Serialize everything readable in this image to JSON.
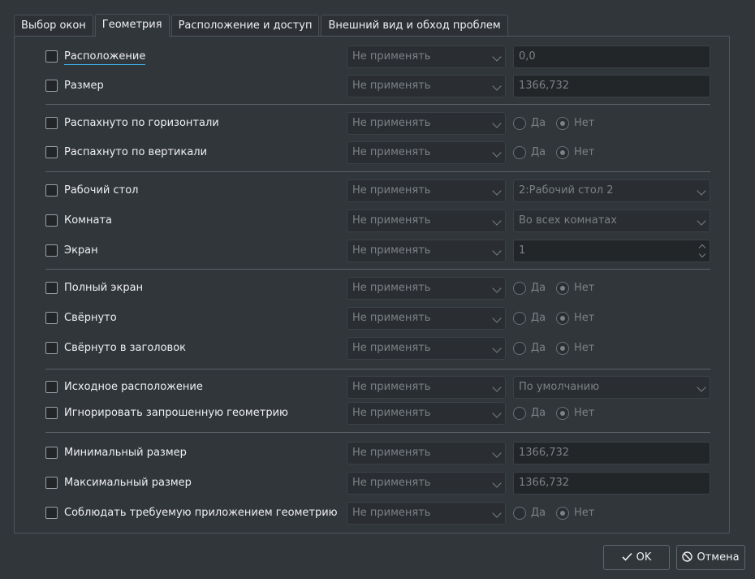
{
  "tabs": [
    "Выбор окон",
    "Геометрия",
    "Расположение и доступ",
    "Внешний вид и обход проблем"
  ],
  "active_tab": "Геометрия",
  "combo_default": "Не применять",
  "radio_yes": "Да",
  "radio_no": "Нет",
  "rows": {
    "position": {
      "label": "Расположение",
      "value": "0,0"
    },
    "size": {
      "label": "Размер",
      "value": "1366,732"
    },
    "max_horiz": {
      "label": "Распахнуто по горизонтали"
    },
    "max_vert": {
      "label": "Распахнуто по вертикали"
    },
    "desktop": {
      "label": "Рабочий стол",
      "value": "2:Рабочий стол 2"
    },
    "activity": {
      "label": "Комната",
      "value": "Во всех комнатах"
    },
    "screen": {
      "label": "Экран",
      "value": "1"
    },
    "fullscreen": {
      "label": "Полный экран"
    },
    "minimized": {
      "label": "Свёрнуто"
    },
    "shaded": {
      "label": "Свёрнуто в заголовок"
    },
    "placement": {
      "label": "Исходное расположение",
      "value": "По умолчанию"
    },
    "ignore_geom": {
      "label": "Игнорировать запрошенную геометрию"
    },
    "min_size": {
      "label": "Минимальный размер",
      "value": "1366,732"
    },
    "max_size": {
      "label": "Максимальный размер",
      "value": "1366,732"
    },
    "obey_geom": {
      "label": "Соблюдать требуемую приложением геометрию"
    }
  },
  "buttons": {
    "ok": "OK",
    "cancel": "Отмена"
  }
}
